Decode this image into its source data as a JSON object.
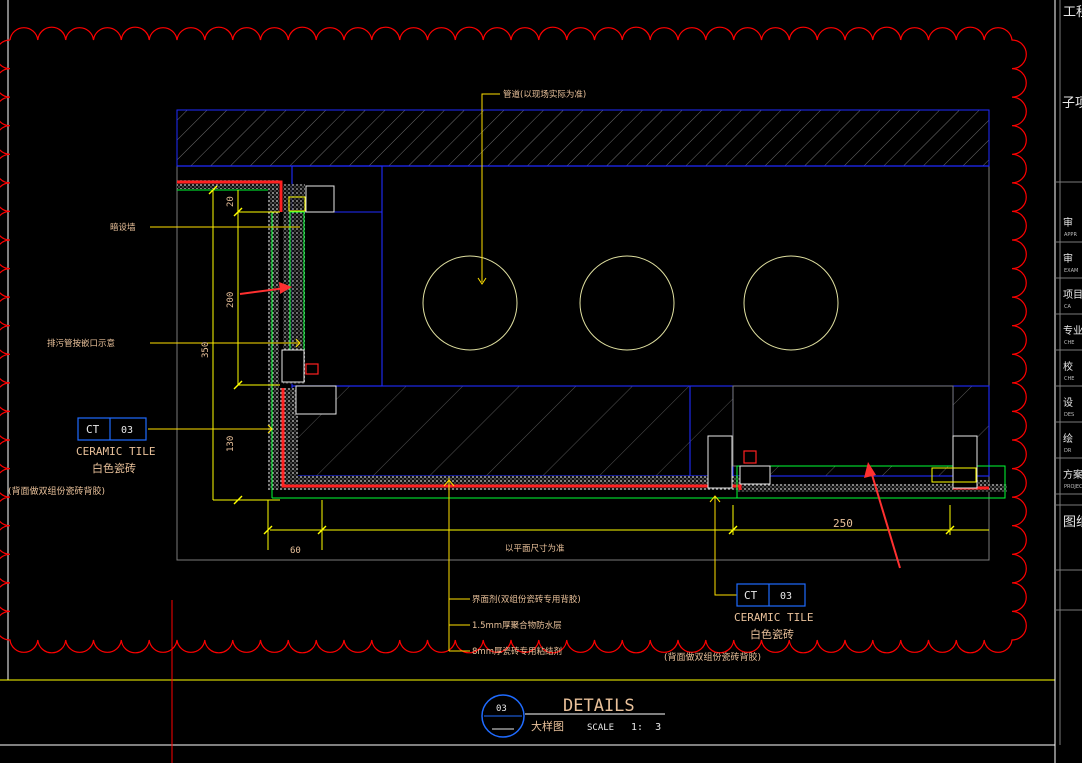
{
  "colors": {
    "background": "#000000",
    "frame": "#ff0000",
    "structure": "#1f2bff",
    "annotation": "#ffff00",
    "leader": "#ffe000",
    "hatch": "#6f6f6f",
    "tile_line": "#00ff33",
    "arrow": "#ff3030",
    "label_text": "#e9c19a",
    "title_block": "#ffffff",
    "gold_text": "#d9b890"
  },
  "annotations": {
    "pipe_note": "管道(以现场实际为准)",
    "left_note_1": "暗设墙",
    "left_note_2": "排污管按嵌口示意",
    "bottom_note_1": "界面剂(双组份瓷砖专用背胶)",
    "bottom_note_2": "1.5mm厚聚合物防水层",
    "bottom_note_3": "8mm厚瓷砖专用粘结剂"
  },
  "dimensions": {
    "d20": "20",
    "d200": "200",
    "d350": "350",
    "d130": "130",
    "d60": "60",
    "d250": "250",
    "center_note": "以平面尺寸为准"
  },
  "tag_left": {
    "code": "CT",
    "number": "03",
    "name_en": "CERAMIC TILE",
    "name_cn": "白色瓷砖",
    "note": "(背面做双组份瓷砖背胶)"
  },
  "tag_right": {
    "code": "CT",
    "number": "03",
    "name_en": "CERAMIC TILE",
    "name_cn": "白色瓷砖",
    "note": "(背面做双组份瓷砖背胶)"
  },
  "title": {
    "bubble_number": "03",
    "heading": "DETAILS",
    "heading_cn": "大样图",
    "scale_label": "SCALE",
    "scale_value": "1:  3"
  },
  "title_block": {
    "row_project": "工程",
    "row_subproject": "子项",
    "rows": [
      {
        "cn": "审",
        "en": "APPR"
      },
      {
        "cn": "审",
        "en": "EXAM"
      },
      {
        "cn": "项目负",
        "en": "CA"
      },
      {
        "cn": "专业负",
        "en": "CHE"
      },
      {
        "cn": "校",
        "en": "CHE"
      },
      {
        "cn": "设",
        "en": "DES"
      },
      {
        "cn": "绘",
        "en": "DR"
      },
      {
        "cn": "方案设",
        "en": "PROJEC"
      }
    ],
    "row_drawing": "图纸"
  }
}
